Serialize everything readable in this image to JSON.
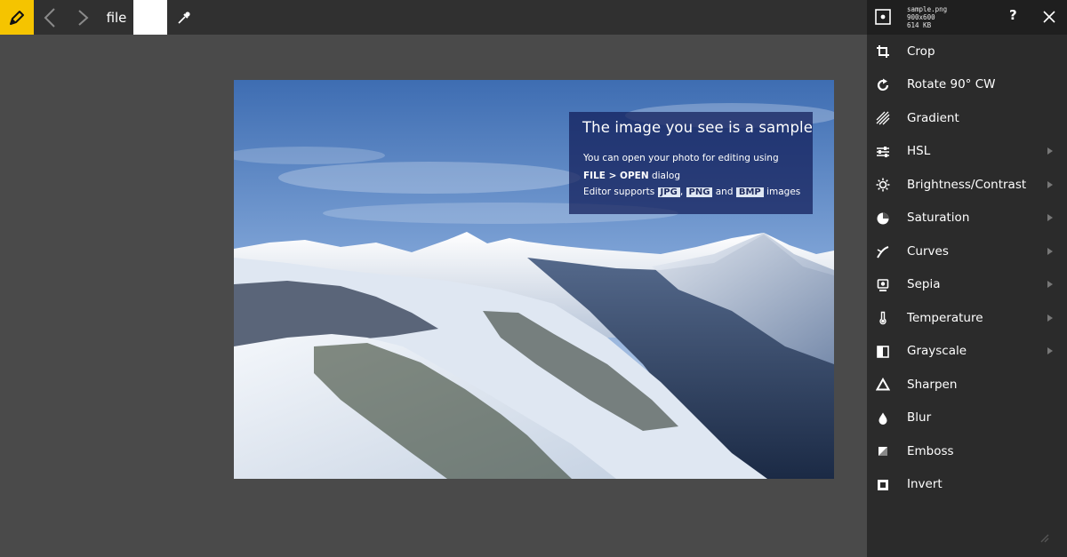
{
  "toolbar": {
    "file_label": "file",
    "icons": [
      "pencil-icon",
      "back-arrow-icon",
      "forward-arrow-icon",
      "eyedropper-icon"
    ],
    "accent_color": "#f5c400",
    "swatch_color": "#ffffff"
  },
  "sample_overlay": {
    "title": "The image you see is a sample",
    "line1": "You can open your photo for editing using",
    "line2_bold": "FILE > OPEN",
    "line2_rest": " dialog",
    "line3_prefix": "Editor supports ",
    "format_1": "JPG",
    "sep_1": ", ",
    "format_2": "PNG",
    "sep_2": " and ",
    "format_3": "BMP",
    "line3_suffix": " images"
  },
  "panel": {
    "file_name": "sample.png",
    "file_dims": "900x600",
    "file_size": "614 KB",
    "help_label": "?",
    "items": [
      {
        "label": "Crop",
        "icon": "crop-icon",
        "submenu": false
      },
      {
        "label": "Rotate 90° CW",
        "icon": "rotate-icon",
        "submenu": false
      },
      {
        "label": "Gradient",
        "icon": "gradient-icon",
        "submenu": false
      },
      {
        "label": "HSL",
        "icon": "hsl-icon",
        "submenu": true
      },
      {
        "label": "Brightness/Contrast",
        "icon": "brightness-icon",
        "submenu": true
      },
      {
        "label": "Saturation",
        "icon": "saturation-icon",
        "submenu": true
      },
      {
        "label": "Curves",
        "icon": "curves-icon",
        "submenu": true
      },
      {
        "label": "Sepia",
        "icon": "sepia-icon",
        "submenu": true
      },
      {
        "label": "Temperature",
        "icon": "temperature-icon",
        "submenu": true
      },
      {
        "label": "Grayscale",
        "icon": "grayscale-icon",
        "submenu": true
      },
      {
        "label": "Sharpen",
        "icon": "sharpen-icon",
        "submenu": false
      },
      {
        "label": "Blur",
        "icon": "blur-icon",
        "submenu": false
      },
      {
        "label": "Emboss",
        "icon": "emboss-icon",
        "submenu": false
      },
      {
        "label": "Invert",
        "icon": "invert-icon",
        "submenu": false
      }
    ]
  }
}
